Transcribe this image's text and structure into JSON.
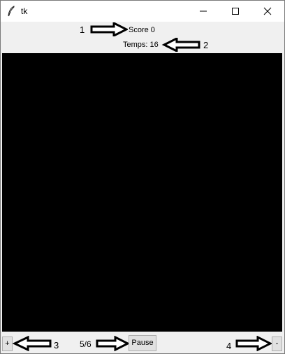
{
  "window": {
    "title": "tk",
    "icons": {
      "app": "feather-icon",
      "minimize": "minimize-icon",
      "maximize": "maximize-icon",
      "close": "close-icon"
    }
  },
  "header": {
    "score_label": "Score 0",
    "temps_label": "Temps: 16"
  },
  "annotations": {
    "marker_1": "1",
    "marker_2": "2",
    "marker_3": "3",
    "marker_4": "4"
  },
  "canvas": {
    "background": "#000000"
  },
  "controls": {
    "plus_label": "+",
    "level_label": "5/6",
    "pause_label": "Pause",
    "minus_label": "-"
  }
}
